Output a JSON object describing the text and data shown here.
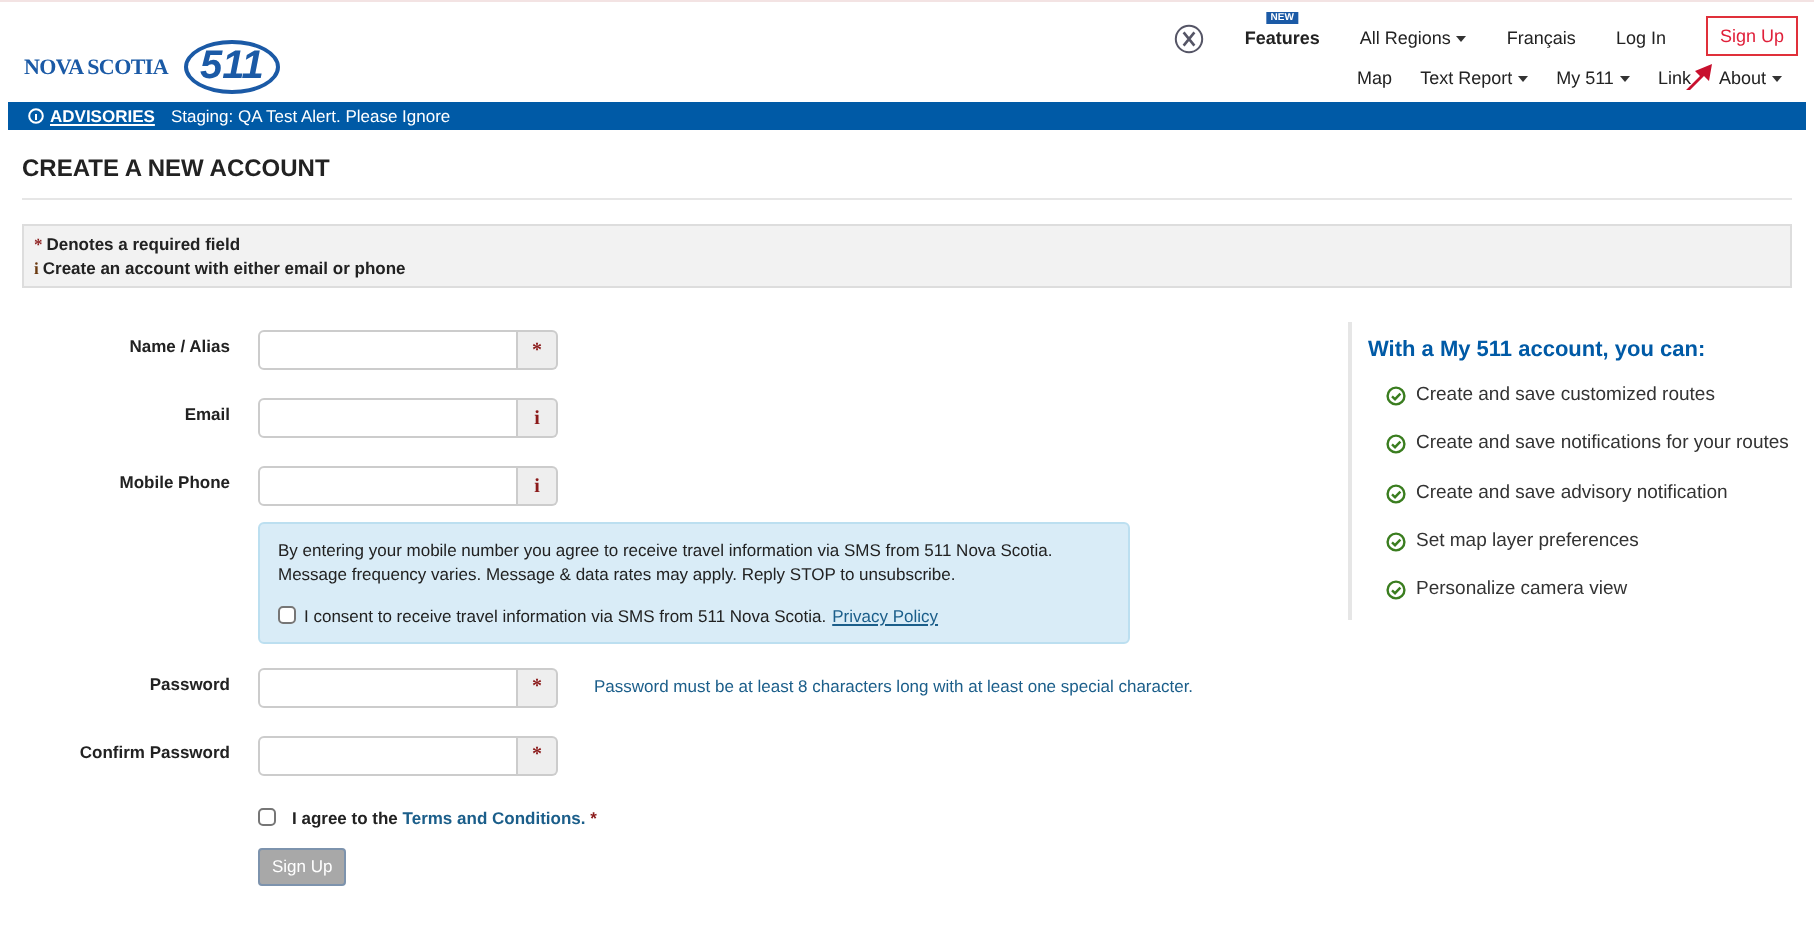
{
  "logo": {
    "name": "NOVA SCOTIA",
    "number": "511"
  },
  "top_nav": [
    {
      "label": "Features",
      "badge": "NEW",
      "kind": "feature"
    },
    {
      "label": "All Regions",
      "kind": "dropdown"
    },
    {
      "label": "Français",
      "kind": "link"
    },
    {
      "label": "Log In",
      "kind": "link"
    },
    {
      "label": "Sign Up",
      "kind": "highlight"
    }
  ],
  "main_nav": [
    {
      "label": "Map",
      "kind": "link"
    },
    {
      "label": "Text Report",
      "kind": "dropdown"
    },
    {
      "label": "My 511",
      "kind": "dropdown"
    },
    {
      "label": "Link",
      "kind": "link"
    },
    {
      "label": "About",
      "kind": "dropdown"
    }
  ],
  "advisory": {
    "label": "ADVISORIES",
    "message": "Staging: QA Test Alert. Please Ignore"
  },
  "page_title": "CREATE A NEW ACCOUNT",
  "notes": [
    {
      "symbol": "*",
      "text": "Denotes a required field",
      "kind": "required"
    },
    {
      "symbol": "i",
      "text": "Create an account with either email or phone",
      "kind": "info"
    }
  ],
  "fields": [
    {
      "label": "Name / Alias",
      "addon": "*",
      "kind": "required"
    },
    {
      "label": "Email",
      "addon": "i",
      "kind": "info"
    },
    {
      "label": "Mobile Phone",
      "addon": "i",
      "kind": "info"
    },
    {
      "kind": "sms",
      "message": "By entering your mobile number you agree to receive travel information via SMS from 511 Nova Scotia. Message frequency varies. Message & data rates may apply. Reply STOP to unsubscribe.",
      "consent": "I consent to receive travel information via SMS from 511 Nova Scotia.",
      "link": "Privacy Policy",
      "checked": false
    },
    {
      "label": "Password",
      "addon": "*",
      "kind": "required",
      "hint": "Password must be at least 8 characters long with at least one special character."
    },
    {
      "label": "Confirm Password",
      "addon": "*",
      "kind": "required"
    }
  ],
  "terms": {
    "prefix": "I agree to the",
    "link": "Terms and Conditions.",
    "mark": "*",
    "checked": false
  },
  "submit": {
    "label": "Sign Up",
    "disabled": true
  },
  "benefits": {
    "title": "With a My 511 account, you can:",
    "items": [
      "Create and save customized routes",
      "Create and save notifications for your routes",
      "Create and save advisory notification",
      "Set map layer preferences",
      "Personalize camera view"
    ]
  }
}
